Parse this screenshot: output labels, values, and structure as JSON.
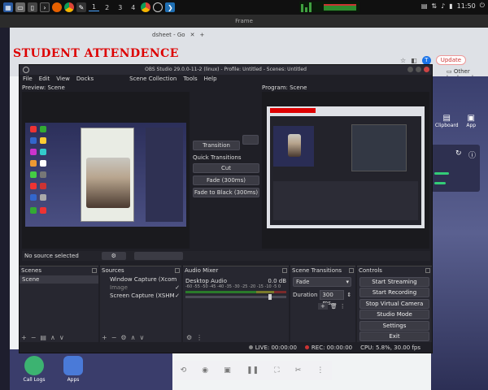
{
  "taskbar": {
    "workspaces": [
      "1",
      "2",
      "3",
      "4"
    ],
    "clock": "11:50"
  },
  "frame_title": "Frame",
  "chrome": {
    "tab_title": "dsheet - Go",
    "update_label": "Update",
    "avatar_letter": "T",
    "bookmarks": "Other bookmark"
  },
  "sheet_heading": "STUDENT ATTENDENCE",
  "phone": {
    "tools": [
      "Clipboard",
      "App"
    ],
    "dock_apps": [
      "Call Logs",
      "Apps"
    ]
  },
  "obs": {
    "window_title": "OBS Studio 29.0.0-11-2 (linux) - Profile: Untitled - Scenes: Untitled",
    "menu_left": [
      "File",
      "Edit",
      "View",
      "Docks"
    ],
    "menu_right": [
      "Scene Collection",
      "Tools",
      "Help"
    ],
    "preview_label": "Preview: Scene",
    "program_label": "Program: Scene",
    "transition": {
      "transition_button": "Transition",
      "quick_label": "Quick Transitions",
      "cut": "Cut",
      "fade": "Fade (300ms)",
      "fade_black": "Fade to Black (300ms)"
    },
    "no_source": "No source selected",
    "scenes": {
      "title": "Scenes",
      "items": [
        "Scene"
      ]
    },
    "sources": {
      "title": "Sources",
      "items": [
        "Window Capture (Xcom",
        "Image",
        "Screen Capture (XSHM"
      ]
    },
    "mixer": {
      "title": "Audio Mixer",
      "channel": "Desktop Audio",
      "level": "0.0 dB",
      "scale": "-60 -55 -50 -45 -40 -35 -30 -25 -20 -15 -10 -5 0"
    },
    "scene_transitions": {
      "title": "Scene Transitions",
      "selected": "Fade",
      "duration_label": "Duration",
      "duration_value": "300 ms"
    },
    "controls": {
      "title": "Controls",
      "buttons": [
        "Start Streaming",
        "Start Recording",
        "Stop Virtual Camera",
        "Studio Mode",
        "Settings",
        "Exit"
      ]
    },
    "status": {
      "live": "LIVE: 00:00:00",
      "rec": "REC: 00:00:00",
      "cpu": "CPU: 5.8%, 30.00 fps"
    }
  },
  "colors": {
    "accent": "#d00000",
    "obs_bg": "#1f1f26",
    "button": "#3b3b44"
  }
}
